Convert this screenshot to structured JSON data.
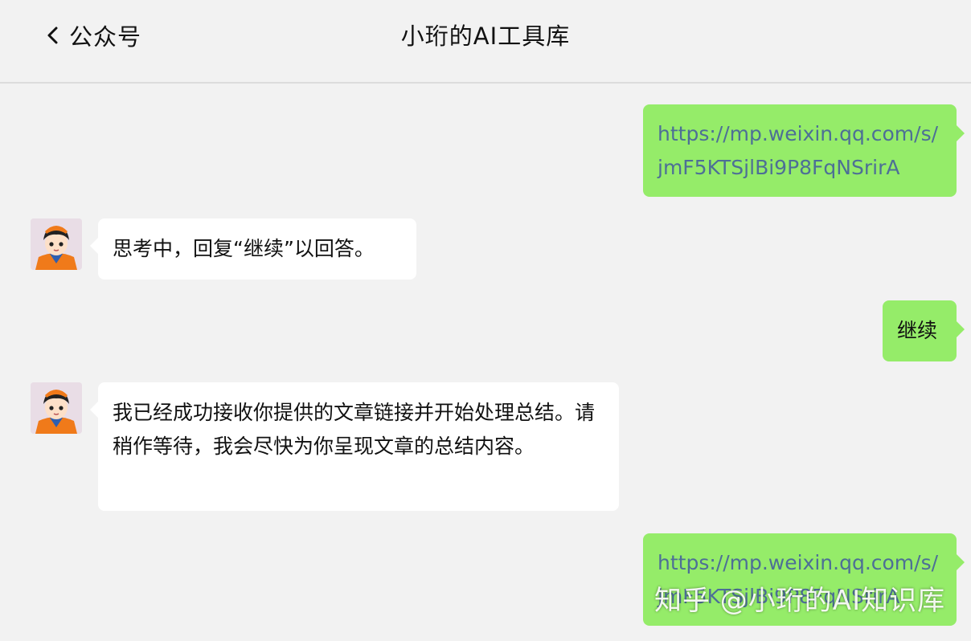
{
  "header": {
    "back_label": "公众号",
    "title": "小珩的AI工具库"
  },
  "messages": [
    {
      "side": "right",
      "type": "link",
      "text": "https://mp.weixin.qq.com/s/ jmF5KTSjlBi9P8FqNSrirA"
    },
    {
      "side": "left",
      "type": "text",
      "text": "思考中，回复“继续”以回答。"
    },
    {
      "side": "right",
      "type": "text",
      "text": "继续"
    },
    {
      "side": "left",
      "type": "text",
      "text": "我已经成功接收你提供的文章链接并开始处理总结。请稍作等待，我会尽快为你呈现文章的总结内容。"
    },
    {
      "side": "right",
      "type": "link",
      "text": "https://mp.weixin.qq.com/s/ jmF5KTSjlBi9P8FqNSrirA"
    }
  ],
  "watermark": "知乎 @小珩的AI知识库",
  "colors": {
    "background": "#f2f2f2",
    "self_bubble": "#95ec69",
    "other_bubble": "#ffffff",
    "link": "#4d6f96"
  },
  "icons": {
    "back": "chevron-left-icon",
    "avatar": "cartoon-boy-avatar"
  }
}
